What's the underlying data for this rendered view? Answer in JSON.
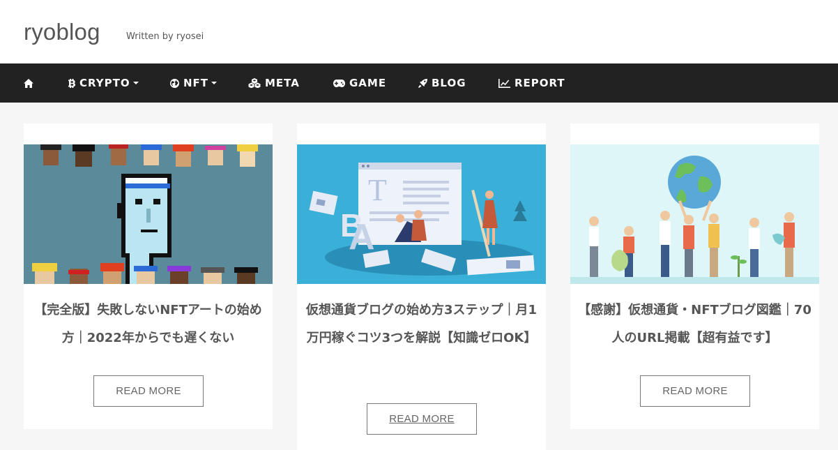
{
  "header": {
    "site_title": "ryoblog",
    "tagline": "Written by ryosei"
  },
  "nav": {
    "home_icon": "home-icon",
    "items": [
      {
        "label": "CRYPTO",
        "icon": "bitcoin-icon",
        "dropdown": true
      },
      {
        "label": "NFT",
        "icon": "globe-icon",
        "dropdown": true
      },
      {
        "label": "META",
        "icon": "cubes-icon",
        "dropdown": false
      },
      {
        "label": "GAME",
        "icon": "gamepad-icon",
        "dropdown": false
      },
      {
        "label": "BLOG",
        "icon": "rocket-icon",
        "dropdown": false
      },
      {
        "label": "REPORT",
        "icon": "line-chart-icon",
        "dropdown": false
      }
    ]
  },
  "posts": [
    {
      "title": "【完全版】失敗しないNFTアートの始め方｜2022年からでも遅くない",
      "read_more": "READ MORE"
    },
    {
      "title": "仮想通貨ブログの始め方3ステップ｜月1万円稼ぐコツ3つを解説【知識ゼロOK】",
      "read_more": "READ MORE"
    },
    {
      "title": "【感謝】仮想通貨・NFTブログ図鑑｜70人のURL掲載【超有益です】",
      "read_more": "READ MORE"
    }
  ],
  "colors": {
    "nav_bg": "#222222",
    "page_bg": "#f6f6f6",
    "thumb1_bg": "#5b8a9b",
    "thumb2_bg": "#3ab0d8",
    "thumb3_bg": "#dff6f8"
  }
}
